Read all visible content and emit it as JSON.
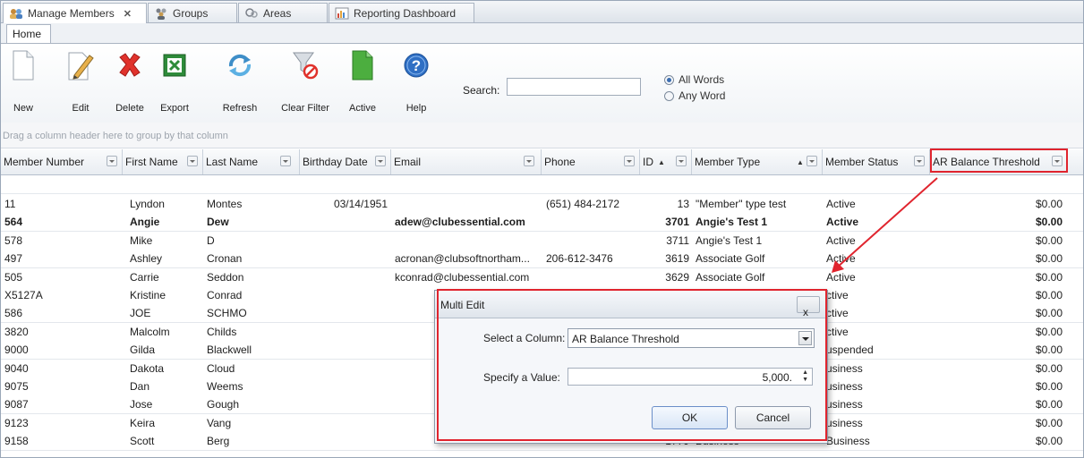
{
  "doc_tabs": [
    {
      "label": "Manage Members",
      "icon": "members-icon",
      "closable": true
    },
    {
      "label": "Groups",
      "icon": "groups-icon"
    },
    {
      "label": "Areas",
      "icon": "areas-icon"
    },
    {
      "label": "Reporting Dashboard",
      "icon": "dashboard-icon"
    }
  ],
  "ribbon": {
    "tab": "Home",
    "buttons": [
      {
        "label": "New",
        "icon": "new-document-icon"
      },
      {
        "label": "Edit",
        "icon": "edit-pencil-icon"
      },
      {
        "label": "Delete",
        "icon": "delete-x-icon"
      },
      {
        "label": "Export",
        "icon": "excel-icon"
      },
      {
        "label": "Refresh",
        "icon": "refresh-icon"
      },
      {
        "label": "Clear Filter",
        "icon": "clear-filter-icon"
      },
      {
        "label": "Active",
        "icon": "active-document-icon"
      },
      {
        "label": "Help",
        "icon": "help-icon"
      }
    ],
    "search_label": "Search:",
    "search_value": "",
    "radio_all": "All Words",
    "radio_any": "Any Word",
    "selected_radio": "All Words"
  },
  "group_panel_text": "Drag a column header here to group by that column",
  "columns": [
    "Member Number",
    "First Name",
    "Last Name",
    "Birthday Date",
    "Email",
    "Phone",
    "ID",
    "Member Type",
    "Member Status",
    "AR Balance Threshold"
  ],
  "rows": [
    {
      "num": "11",
      "first": "Lyndon",
      "last": "Montes",
      "bday": "03/14/1951",
      "email": "",
      "phone": "(651) 484-2172",
      "id": "13",
      "type": "\"Member\" type test",
      "status": "Active",
      "ar": "$0.00",
      "bold": false
    },
    {
      "num": "564",
      "first": "Angie",
      "last": "Dew",
      "bday": "",
      "email": "adew@clubessential.com",
      "phone": "",
      "id": "3701",
      "type": "Angie's Test 1",
      "status": "Active",
      "ar": "$0.00",
      "bold": true
    },
    {
      "num": "578",
      "first": "Mike",
      "last": "D",
      "bday": "",
      "email": "",
      "phone": "",
      "id": "3711",
      "type": "Angie's Test 1",
      "status": "Active",
      "ar": "$0.00",
      "bold": false
    },
    {
      "num": "497",
      "first": "Ashley",
      "last": "Cronan",
      "bday": "",
      "email": "acronan@clubsoftnortham...",
      "phone": "206-612-3476",
      "id": "3619",
      "type": "Associate Golf",
      "status": "Active",
      "ar": "$0.00",
      "bold": false
    },
    {
      "num": "505",
      "first": "Carrie",
      "last": "Seddon",
      "bday": "",
      "email": "kconrad@clubessential.com",
      "phone": "",
      "id": "3629",
      "type": "Associate Golf",
      "status": "Active",
      "ar": "$0.00",
      "bold": false
    },
    {
      "num": "X5127A",
      "first": "Kristine",
      "last": "Conrad",
      "bday": "",
      "email": "",
      "phone": "",
      "id": "",
      "type": "",
      "status": "ctive",
      "ar": "$0.00",
      "bold": false
    },
    {
      "num": "586",
      "first": "JOE",
      "last": "SCHMO",
      "bday": "",
      "email": "",
      "phone": "",
      "id": "",
      "type": "",
      "status": "ctive",
      "ar": "$0.00",
      "bold": false
    },
    {
      "num": "3820",
      "first": "Malcolm",
      "last": "Childs",
      "bday": "",
      "email": "",
      "phone": "",
      "id": "",
      "type": "",
      "status": "ctive",
      "ar": "$0.00",
      "bold": false
    },
    {
      "num": "9000",
      "first": "Gilda",
      "last": "Blackwell",
      "bday": "",
      "email": "",
      "phone": "",
      "id": "",
      "type": "",
      "status": "uspended",
      "ar": "$0.00",
      "bold": false
    },
    {
      "num": "9040",
      "first": "Dakota",
      "last": "Cloud",
      "bday": "",
      "email": "",
      "phone": "",
      "id": "",
      "type": "",
      "status": "usiness",
      "ar": "$0.00",
      "bold": false
    },
    {
      "num": "9075",
      "first": "Dan",
      "last": "Weems",
      "bday": "",
      "email": "",
      "phone": "",
      "id": "",
      "type": "",
      "status": "usiness",
      "ar": "$0.00",
      "bold": false
    },
    {
      "num": "9087",
      "first": "Jose",
      "last": "Gough",
      "bday": "",
      "email": "",
      "phone": "",
      "id": "",
      "type": "",
      "status": "usiness",
      "ar": "$0.00",
      "bold": false
    },
    {
      "num": "9123",
      "first": "Keira",
      "last": "Vang",
      "bday": "",
      "email": "",
      "phone": "",
      "id": "",
      "type": "",
      "status": "usiness",
      "ar": "$0.00",
      "bold": false
    },
    {
      "num": "9158",
      "first": "Scott",
      "last": "Berg",
      "bday": "",
      "email": "",
      "phone": "",
      "id": "1779",
      "type": "Business",
      "status": "Business",
      "ar": "$0.00",
      "bold": false
    }
  ],
  "dialog": {
    "title": "Multi Edit",
    "close": "x",
    "column_label": "Select a Column:",
    "column_value": "AR Balance Threshold",
    "value_label": "Specify a Value:",
    "value": "5,000.",
    "ok": "OK",
    "cancel": "Cancel"
  },
  "colors": {
    "highlight": "#e0242e",
    "accent": "#3b6db0"
  }
}
